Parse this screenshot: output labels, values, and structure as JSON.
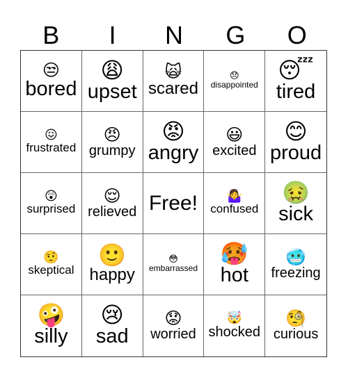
{
  "header": {
    "letters": [
      "B",
      "I",
      "N",
      "G",
      "O"
    ]
  },
  "cells": [
    {
      "emoji": "😒",
      "emoji_name": "unamused-face-icon",
      "label": "bored"
    },
    {
      "emoji": "😩",
      "emoji_name": "weary-face-icon",
      "label": "upset"
    },
    {
      "emoji": "🙀",
      "emoji_name": "weary-cat-icon",
      "label": "scared"
    },
    {
      "emoji": "😞",
      "emoji_name": "disappointed-face-icon",
      "label": "disappointed"
    },
    {
      "emoji": "😴",
      "emoji_name": "sleeping-face-icon",
      "label": "tired"
    },
    {
      "emoji": "😖",
      "emoji_name": "confounded-face-icon",
      "label": "frustrated"
    },
    {
      "emoji": "😠",
      "emoji_name": "angry-face-icon",
      "label": "grumpy"
    },
    {
      "emoji": "😡",
      "emoji_name": "pouting-face-icon",
      "label": "angry"
    },
    {
      "emoji": "😃",
      "emoji_name": "grinning-face-icon",
      "label": "excited"
    },
    {
      "emoji": "😊",
      "emoji_name": "smiling-face-icon",
      "label": "proud"
    },
    {
      "emoji": "😲",
      "emoji_name": "astonished-face-icon",
      "label": "surprised"
    },
    {
      "emoji": "😌",
      "emoji_name": "relieved-face-icon",
      "label": "relieved"
    },
    {
      "emoji": "",
      "emoji_name": "",
      "label": "Free!"
    },
    {
      "emoji": "🤷‍♀️",
      "emoji_name": "shrugging-woman-icon",
      "label": "confused"
    },
    {
      "emoji": "🤢",
      "emoji_name": "nauseated-face-icon",
      "label": "sick"
    },
    {
      "emoji": "🤨",
      "emoji_name": "raised-eyebrow-face-icon",
      "label": "skeptical"
    },
    {
      "emoji": "🙂",
      "emoji_name": "slightly-smiling-face-icon",
      "label": "happy"
    },
    {
      "emoji": "😳",
      "emoji_name": "flushed-face-icon",
      "label": "embarrassed"
    },
    {
      "emoji": "🥵",
      "emoji_name": "hot-face-icon",
      "label": "hot"
    },
    {
      "emoji": "🥶",
      "emoji_name": "cold-face-icon",
      "label": "freezing"
    },
    {
      "emoji": "🤪",
      "emoji_name": "zany-face-icon",
      "label": "silly"
    },
    {
      "emoji": "😢",
      "emoji_name": "crying-face-icon",
      "label": "sad"
    },
    {
      "emoji": "😟",
      "emoji_name": "worried-face-icon",
      "label": "worried"
    },
    {
      "emoji": "🤯",
      "emoji_name": "exploding-head-icon",
      "label": "shocked"
    },
    {
      "emoji": "🧐",
      "emoji_name": "monocle-face-icon",
      "label": "curious"
    }
  ]
}
